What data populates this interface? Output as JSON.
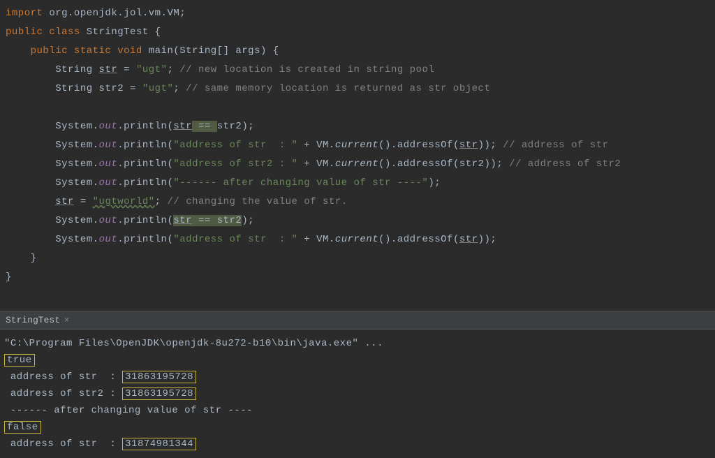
{
  "code": {
    "l1_import": "import",
    "l1_pkg": " org.openjdk.jol.vm.VM;",
    "l2_public": "public class",
    "l2_cls": " StringTest ",
    "l2_brace": "{",
    "l3_mods": "public static void",
    "l3_name": " main",
    "l3_params": "(String[] args) {",
    "l4_type": "String ",
    "l4_var": "str",
    "l4_assign": " = ",
    "l4_val": "\"ugt\"",
    "l4_semi": "; ",
    "l4_cmt": "// new location is created in string pool",
    "l5_type": "String str2 = ",
    "l5_val": "\"ugt\"",
    "l5_semi": "; ",
    "l5_cmt": "// same memory location is returned as str object",
    "l6_sys": "System.",
    "l6_out": "out",
    "l6_print": ".println(",
    "l6_arg1": "str",
    "l6_eq": " == ",
    "l6_arg2": "str2",
    "l6_close": ");",
    "l7_str": "\"address of str  : \"",
    "l7_plus": " + VM.",
    "l7_cur": "current",
    "l7_addr": "().addressOf(",
    "l7_var": "str",
    "l7_end": ")); ",
    "l7_cmt": "// address of str",
    "l8_str": "\"address of str2 : \"",
    "l8_var": "str2",
    "l8_cmt": "// address of str2",
    "l9_str": "\"------ after changing value of str ----\"",
    "l9_close": ");",
    "l10_var": "str",
    "l10_assign": " = ",
    "l10_val": "\"ugtworld\"",
    "l10_semi": "; ",
    "l10_cmt": "// changing the value of str.",
    "l11_arg1": "str",
    "l11_eq": " == ",
    "l11_arg2": "str2",
    "l12_str": "\"address of str  : \"",
    "l12_var": "str",
    "l12_end": "));",
    "cbrace1": "}",
    "cbrace2": "}"
  },
  "tab": {
    "name": "StringTest",
    "close": "×"
  },
  "console": {
    "cmd": "\"C:\\Program Files\\OpenJDK\\openjdk-8u272-b10\\bin\\java.exe\" ...",
    "out1": "true",
    "out2a": "address of str  : ",
    "out2b": "31863195728",
    "out3a": "address of str2 : ",
    "out3b": "31863195728",
    "out4": " ------ after changing value of str ----",
    "out5": "false",
    "out6a": "address of str  : ",
    "out6b": "31874981344"
  }
}
